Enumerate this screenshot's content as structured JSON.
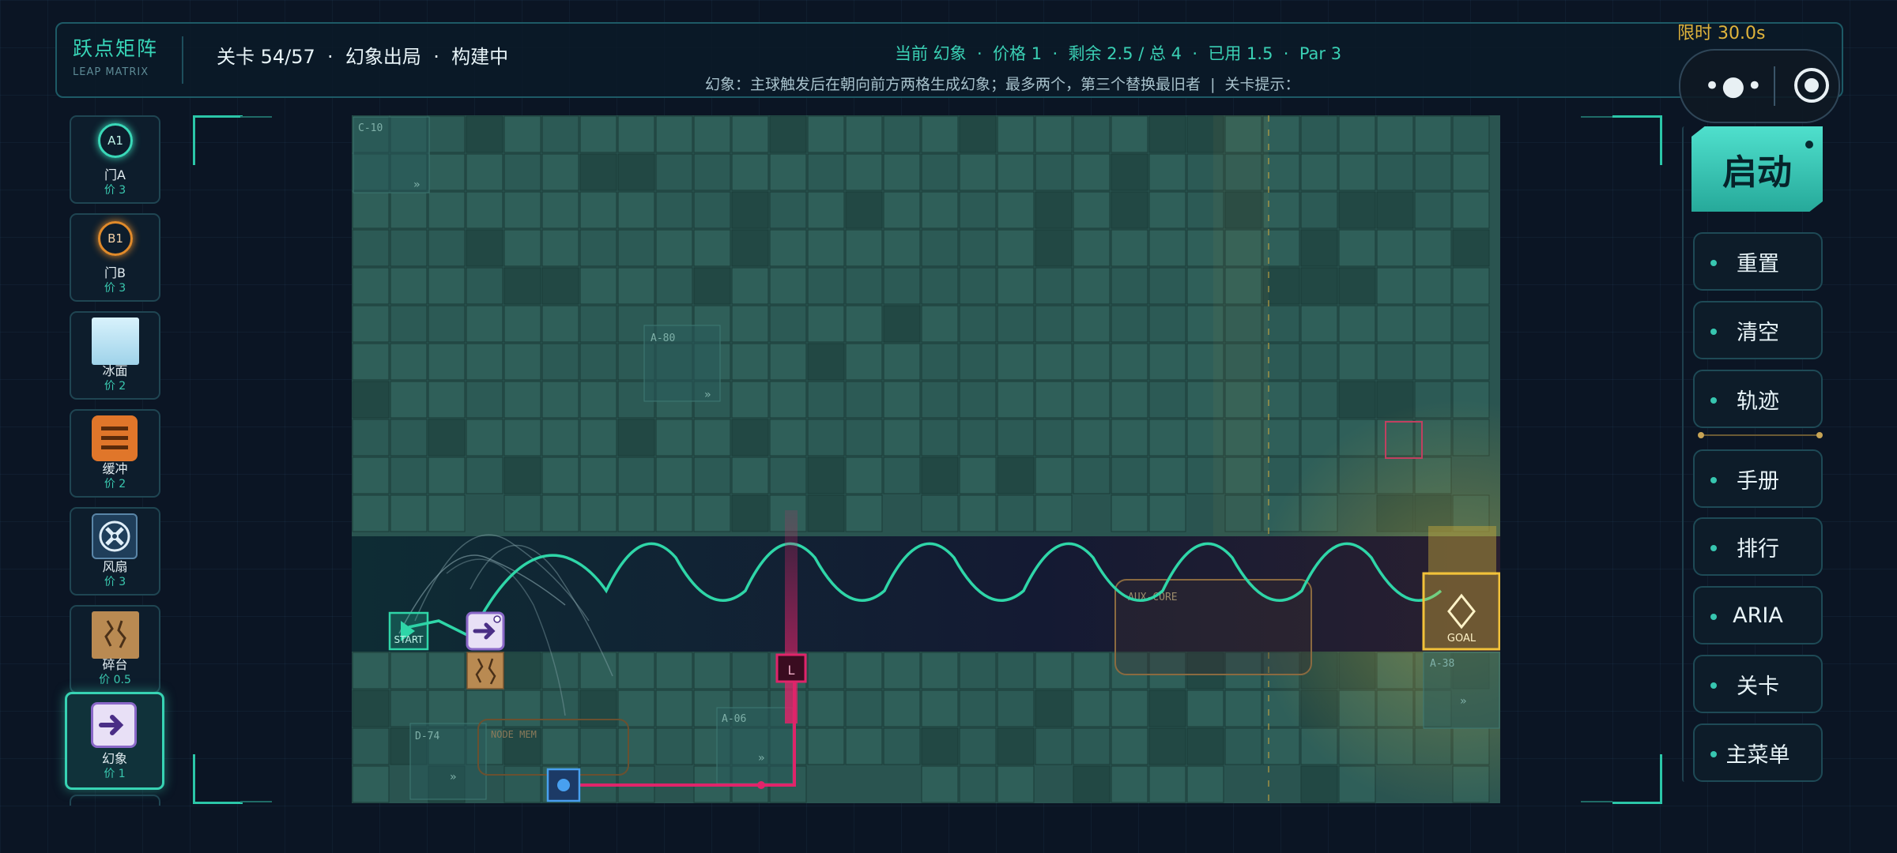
{
  "header": {
    "logo_title": "跃点矩阵",
    "logo_subtitle": "LEAP MATRIX",
    "level_info": "关卡 54/57  ·  幻象出局  ·  构建中",
    "stats": "当前 幻象  ·  价格 1  ·  剩余 2.5 / 总 4  ·  已用 1.5  ·  Par 3",
    "hint": "幻象：主球触发后在朝向前方两格生成幻象；最多两个，第三个替换最旧者  |  关卡提示：",
    "timer": "限时 30.0s"
  },
  "palette": [
    {
      "name": "门A",
      "price": "价 3",
      "glyph": "A1",
      "icon": "gate-a-icon"
    },
    {
      "name": "门B",
      "price": "价 3",
      "glyph": "B1",
      "icon": "gate-b-icon"
    },
    {
      "name": "冰面",
      "price": "价 2",
      "glyph": "",
      "icon": "ice-icon"
    },
    {
      "name": "缓冲",
      "price": "价 2",
      "glyph": "",
      "icon": "buffer-icon"
    },
    {
      "name": "风扇",
      "price": "价 3",
      "glyph": "",
      "icon": "fan-icon"
    },
    {
      "name": "碎台",
      "price": "价 0.5",
      "glyph": "",
      "icon": "crumble-icon"
    },
    {
      "name": "幻象",
      "price": "价 1",
      "glyph": "",
      "icon": "phantom-icon"
    }
  ],
  "board": {
    "zone_labels": [
      "C-10",
      "A-80",
      "AUX-CORE",
      "A-38",
      "D-74",
      "NODE MEM",
      "A-06"
    ],
    "start_label": "START",
    "goal_label": "GOAL",
    "laser_label": "L",
    "colors": {
      "trajectory": "#2fd6a8",
      "laser": "#e0246a",
      "goal": "#f2c23a",
      "tile": "#2a5450"
    }
  },
  "controls": {
    "start": "启动",
    "buttons": [
      "重置",
      "清空",
      "轨迹",
      "手册",
      "排行",
      "ARIA",
      "关卡",
      "主菜单"
    ]
  }
}
